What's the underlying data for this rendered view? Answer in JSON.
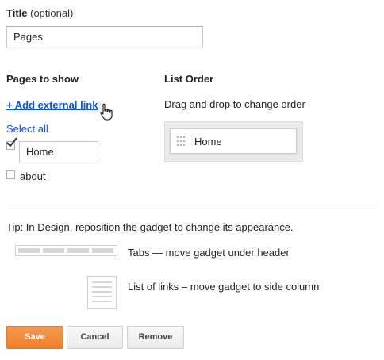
{
  "title_section": {
    "label": "Title",
    "optional_note": "(optional)",
    "value": "Pages"
  },
  "pages_section": {
    "heading": "Pages to show",
    "add_link": "+ Add external link",
    "select_all": "Select all",
    "pages": [
      {
        "label": "Home",
        "checked": true,
        "editable": true
      },
      {
        "label": "about",
        "checked": false,
        "editable": false
      }
    ]
  },
  "order_section": {
    "heading": "List Order",
    "instructions": "Drag and drop to change order",
    "items": [
      "Home"
    ]
  },
  "tip": {
    "text": "Tip: In Design, reposition the gadget to change its appearance.",
    "tabs_label": "Tabs — move gadget under header",
    "list_label": "List of links – move gadget to side column"
  },
  "buttons": {
    "save": "Save",
    "cancel": "Cancel",
    "remove": "Remove"
  },
  "colors": {
    "link": "#1155cc",
    "save_button": "#f07e2a",
    "order_box": "#ebebeb"
  },
  "icons": [
    "checkmark-icon",
    "pointer-hand-icon",
    "drag-grip-icon",
    "tabs-layout-icon",
    "list-layout-icon"
  ]
}
